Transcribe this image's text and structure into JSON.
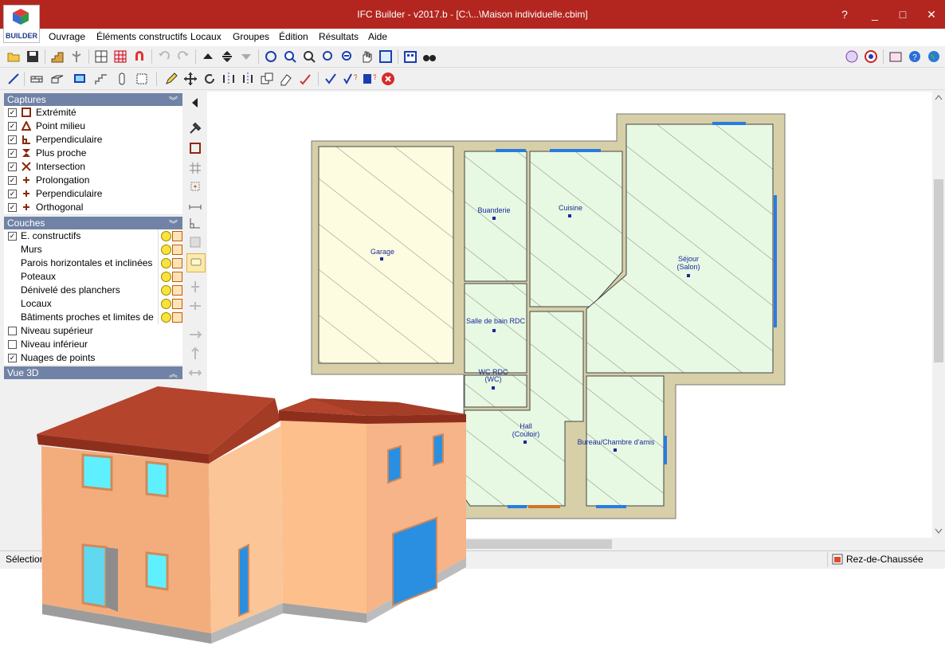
{
  "window": {
    "title": "IFC Builder - v2017.b - [C:\\...\\Maison individuelle.cbim]",
    "logo_label": "BUILDER",
    "controls": {
      "help": "?",
      "minimize": "_",
      "maximize": "□",
      "close": "✕"
    }
  },
  "menu": [
    "Ouvrage",
    "Éléments constructifs",
    "Locaux",
    "Groupes",
    "Édition",
    "Résultats",
    "Aide"
  ],
  "captures": {
    "title": "Captures",
    "items": [
      {
        "label": "Extrémité",
        "checked": true,
        "icon": "square-icon"
      },
      {
        "label": "Point milieu",
        "checked": true,
        "icon": "triangle-icon"
      },
      {
        "label": "Perpendiculaire",
        "checked": true,
        "icon": "perpendicular-icon"
      },
      {
        "label": "Plus proche",
        "checked": true,
        "icon": "hourglass-icon"
      },
      {
        "label": "Intersection",
        "checked": true,
        "icon": "cross-icon"
      },
      {
        "label": "Prolongation",
        "checked": true,
        "icon": "plus-icon"
      },
      {
        "label": "Perpendiculaire",
        "checked": true,
        "icon": "plus-icon"
      },
      {
        "label": "Orthogonal",
        "checked": true,
        "icon": "plus-icon"
      }
    ]
  },
  "couches": {
    "title": "Couches",
    "items": [
      {
        "label": "E. constructifs",
        "checked": true,
        "indent": false,
        "tools": true
      },
      {
        "label": "Murs",
        "checked": null,
        "indent": true,
        "tools": true
      },
      {
        "label": "Parois horizontales et inclinées",
        "checked": null,
        "indent": true,
        "tools": true
      },
      {
        "label": "Poteaux",
        "checked": null,
        "indent": true,
        "tools": true
      },
      {
        "label": "Dénivelé des planchers",
        "checked": null,
        "indent": true,
        "tools": true
      },
      {
        "label": "Locaux",
        "checked": null,
        "indent": true,
        "tools": true
      },
      {
        "label": "Bâtiments proches et limites de l...",
        "checked": null,
        "indent": true,
        "tools": true
      },
      {
        "label": "Niveau supérieur",
        "checked": false,
        "indent": false,
        "tools": false
      },
      {
        "label": "Niveau inférieur",
        "checked": false,
        "indent": false,
        "tools": false
      },
      {
        "label": "Nuages de points",
        "checked": true,
        "indent": false,
        "tools": false
      }
    ]
  },
  "vue3d": {
    "title": "Vue 3D"
  },
  "plan": {
    "rooms": [
      {
        "name": "Garage",
        "sub": ""
      },
      {
        "name": "Buanderie",
        "sub": ""
      },
      {
        "name": "Cuisine",
        "sub": ""
      },
      {
        "name": "Séjour",
        "sub": "(Salon)"
      },
      {
        "name": "Salle de bain RDC",
        "sub": ""
      },
      {
        "name": "WC RDC",
        "sub": "(WC)"
      },
      {
        "name": "Hall",
        "sub": "(Couloir)"
      },
      {
        "name": "Bureau/Chambre d'amis",
        "sub": ""
      }
    ]
  },
  "status": {
    "left": "Sélection",
    "level": "Rez-de-Chaussée"
  },
  "colors": {
    "title_bar": "#b3261f",
    "panel_header": "#7083a6",
    "plan_room": "#e7f8e3",
    "plan_garage": "#fdfbe0",
    "plan_wall": "#d6cfa8",
    "label": "#1a2a9a"
  }
}
